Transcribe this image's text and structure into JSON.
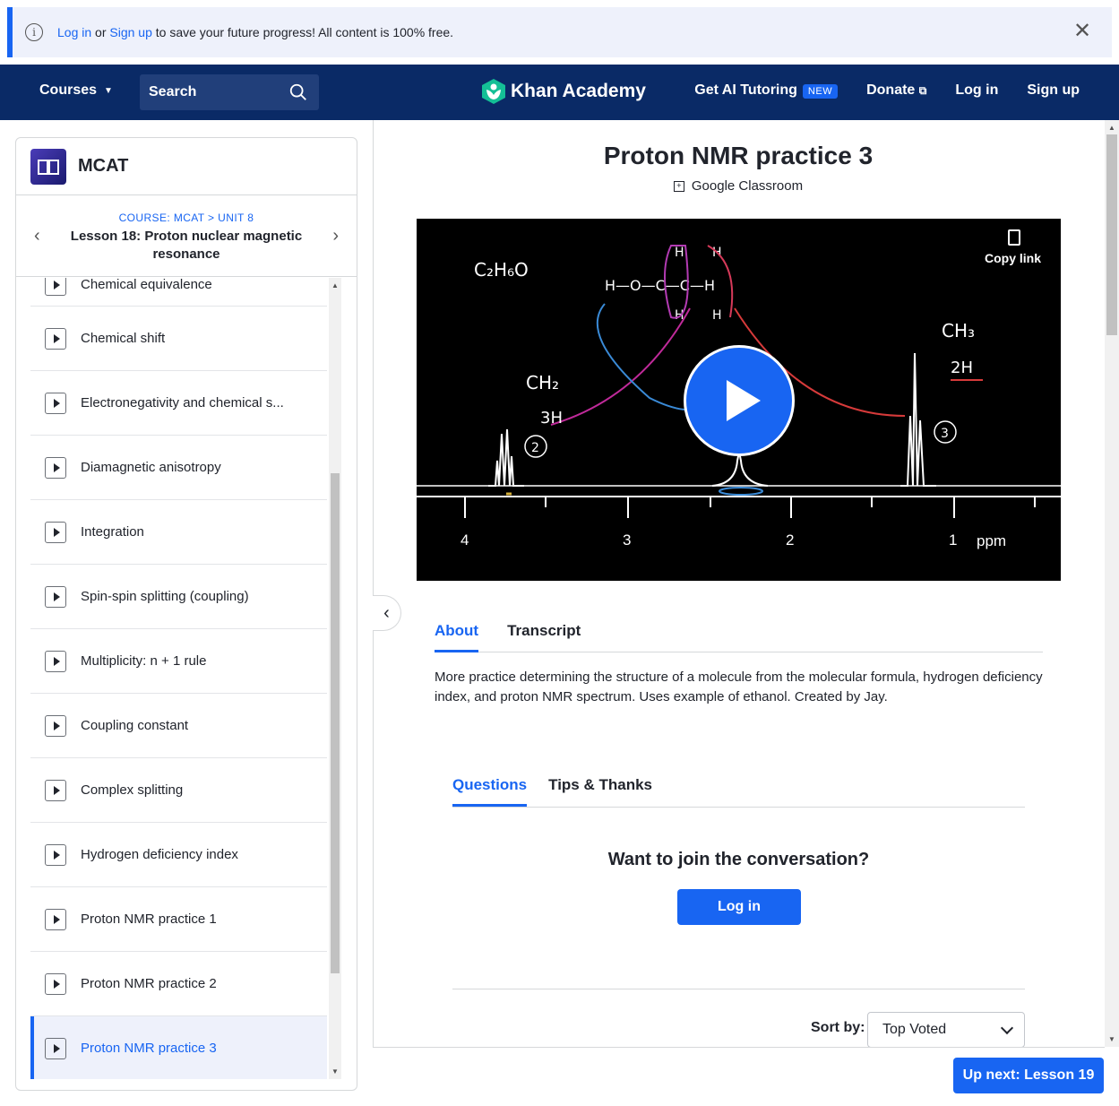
{
  "banner": {
    "login_link": "Log in",
    "or": "or",
    "signup_link": "Sign up",
    "message": "to save your future progress! All content is 100% free."
  },
  "nav": {
    "courses": "Courses",
    "search": "Search",
    "logo": "Khan Academy",
    "ai_tutoring": "Get AI Tutoring",
    "new_badge": "NEW",
    "donate": "Donate",
    "login": "Log in",
    "signup": "Sign up"
  },
  "sidebar": {
    "course_title": "MCAT",
    "breadcrumb": "COURSE: MCAT > UNIT 8",
    "lesson_title": "Lesson 18: Proton nuclear magnetic resonance",
    "partial_item": "Chemical equivalence",
    "items": [
      {
        "label": "Chemical shift"
      },
      {
        "label": "Electronegativity and chemical s..."
      },
      {
        "label": "Diamagnetic anisotropy"
      },
      {
        "label": "Integration"
      },
      {
        "label": "Spin-spin splitting (coupling)"
      },
      {
        "label": "Multiplicity: n + 1 rule"
      },
      {
        "label": "Coupling constant"
      },
      {
        "label": "Complex splitting"
      },
      {
        "label": "Hydrogen deficiency index"
      },
      {
        "label": "Proton NMR practice 1"
      },
      {
        "label": "Proton NMR practice 2"
      },
      {
        "label": "Proton NMR practice 3"
      }
    ]
  },
  "main": {
    "title": "Proton NMR practice 3",
    "google_classroom": "Google Classroom",
    "copy_link": "Copy link",
    "video_labels": {
      "formula": "C₂H₆O",
      "ch2": "CH₂",
      "three_h": "3H",
      "ch3": "CH₃",
      "two_h": "2H",
      "axis": [
        "4",
        "3",
        "2",
        "1",
        "ppm"
      ]
    },
    "tabs": [
      "About",
      "Transcript"
    ],
    "about": "More practice determining the structure of a molecule from the molecular formula, hydrogen deficiency index, and proton NMR spectrum. Uses example of ethanol. Created by Jay.",
    "discussion_tabs": [
      "Questions",
      "Tips & Thanks"
    ],
    "join_prompt": "Want to join the conversation?",
    "login_button": "Log in",
    "sort_label": "Sort by:",
    "sort_value": "Top Voted",
    "up_next": "Up next: Lesson 19"
  },
  "colors": {
    "brand_blue": "#1865f2",
    "nav_bg": "#0a2a66",
    "banner_bg": "#eef1fb"
  }
}
